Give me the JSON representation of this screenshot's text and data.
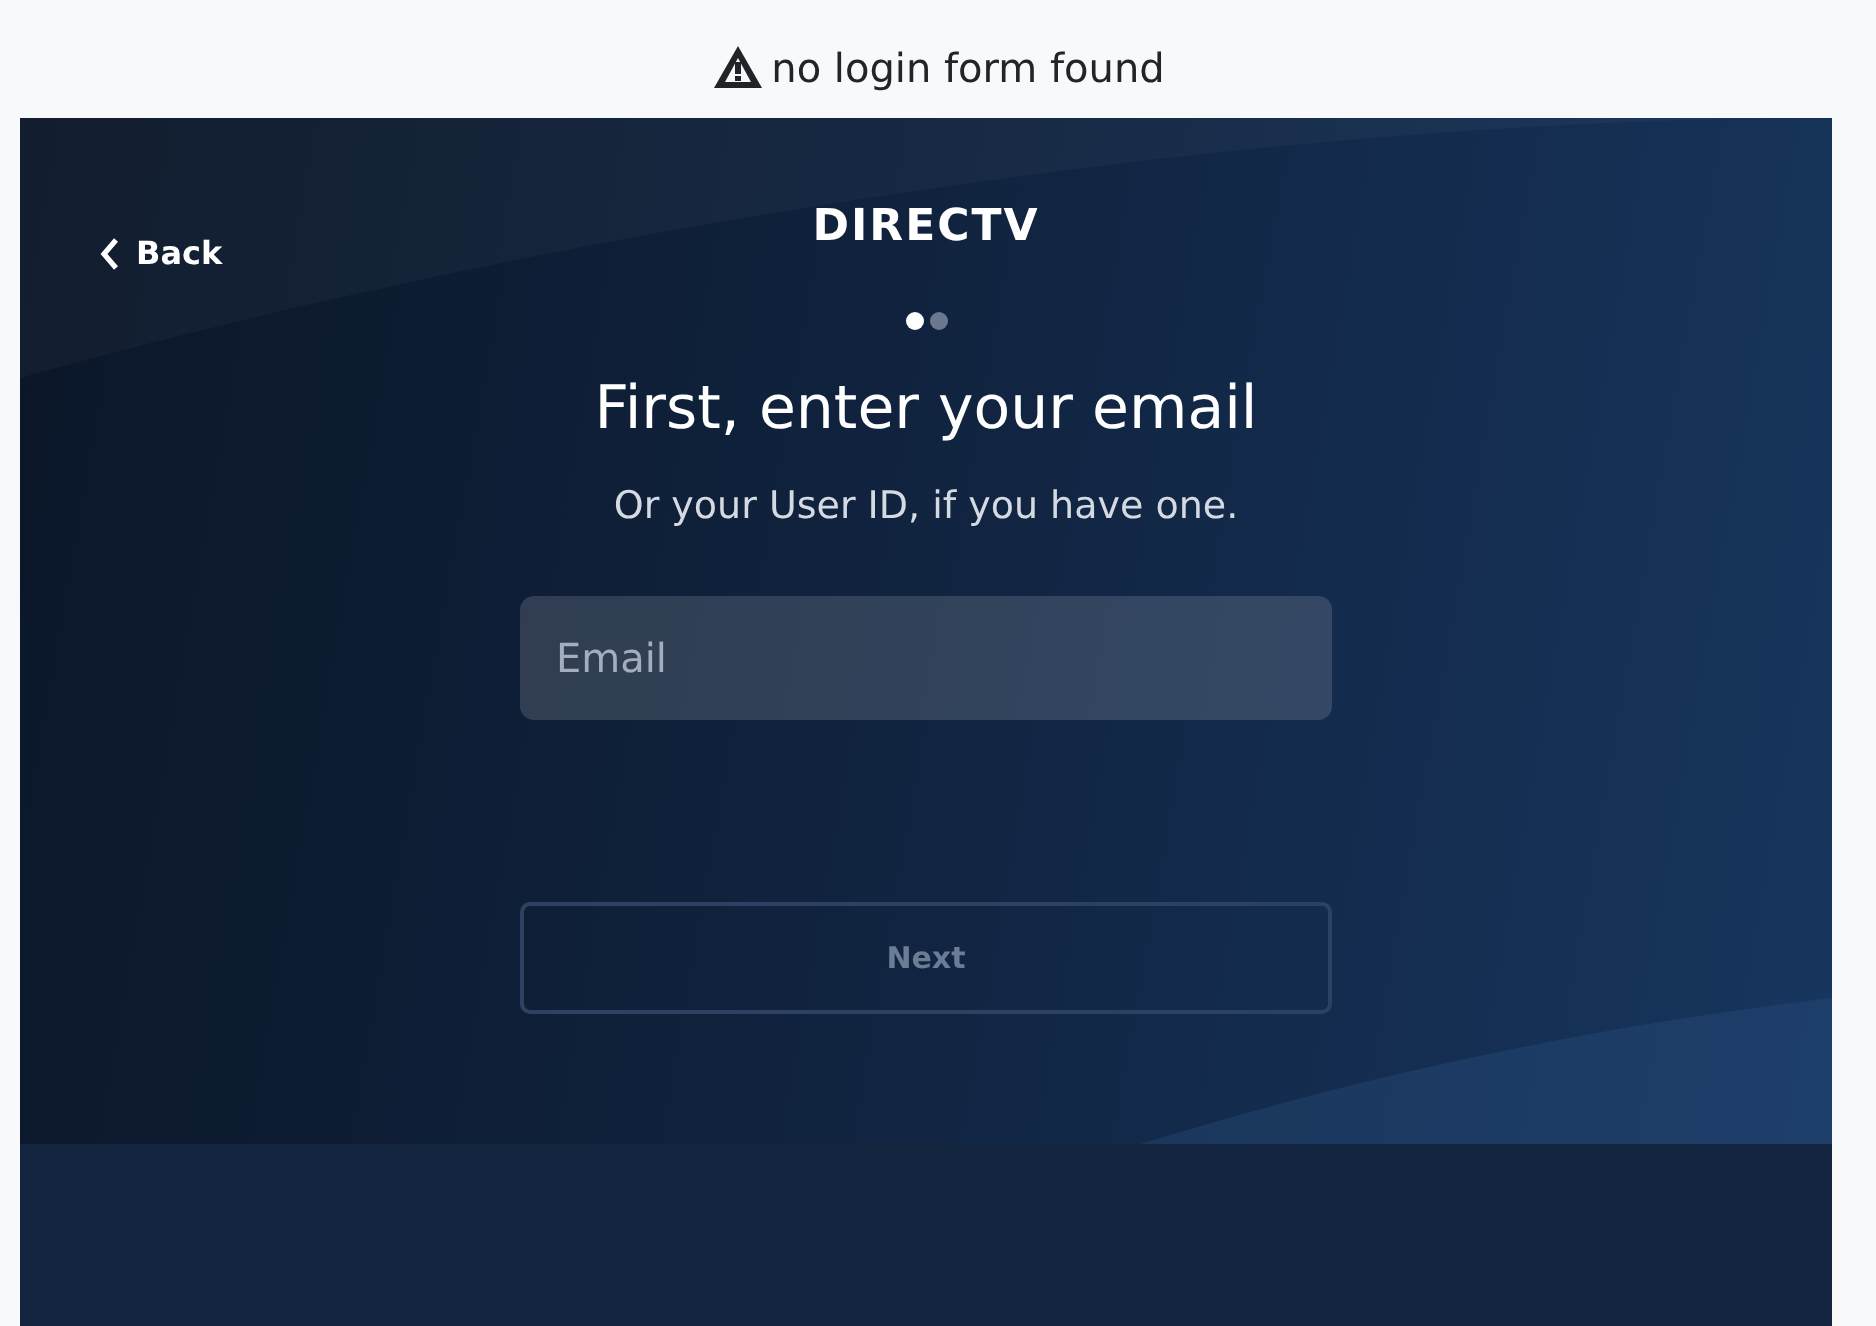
{
  "banner": {
    "message": "no login form found"
  },
  "screen": {
    "back": {
      "label": "Back"
    },
    "logo": "DIRECTV",
    "steps": [
      {
        "selected": true
      },
      {
        "selected": false
      }
    ],
    "heading": "First, enter your email",
    "subheading": "Or your User ID, if you have one.",
    "email_field": {
      "placeholder": "Email"
    },
    "next_button": {
      "label": "Next",
      "disabled": true
    }
  }
}
